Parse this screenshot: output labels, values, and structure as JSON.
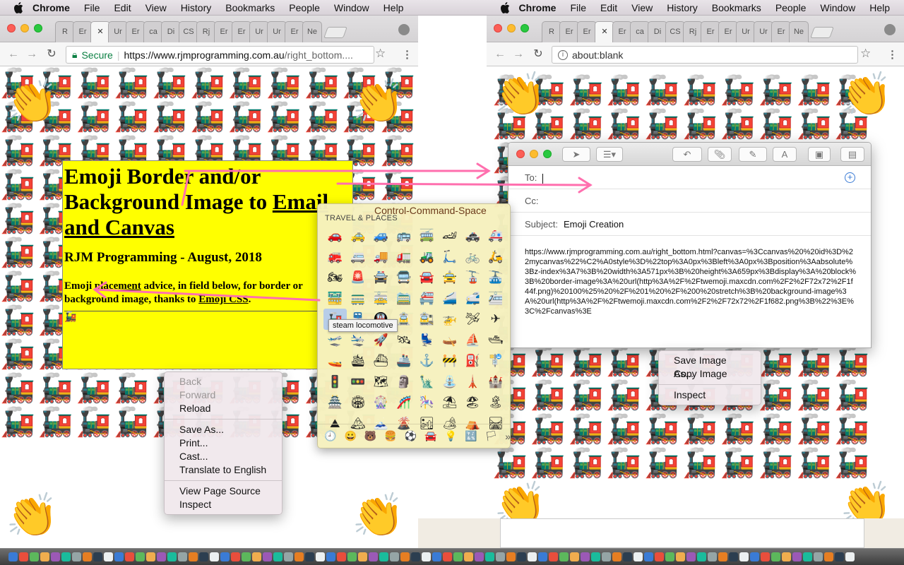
{
  "menubar": {
    "app": "Chrome",
    "items": [
      "File",
      "Edit",
      "View",
      "History",
      "Bookmarks",
      "People",
      "Window",
      "Help"
    ]
  },
  "left_browser": {
    "tabs": [
      "R",
      "Er",
      "",
      "Ur",
      "Er",
      "ca",
      "Di",
      "CS",
      "Rj",
      "Er",
      "Er",
      "Ur",
      "Ur",
      "Er",
      "Ne"
    ],
    "active_tab": 2,
    "secure_label": "Secure",
    "url_host": "https://www.rjmprogramming.com.au",
    "url_rest": "/right_bottom....",
    "page": {
      "title_line1": "Emoji Border and/or",
      "title_line2a": "Background Image to ",
      "title_link": "Email",
      "title_line3": "and Canvas",
      "subtitle": "RJM Programming - August, 2018",
      "para_start": "Emoji ",
      "para_link1": "placement",
      "para_mid": " advice, in field below, for border or background image, thanks to ",
      "para_link2": "Emoji CSS",
      "para_end": ".",
      "field_value": "🚂"
    }
  },
  "right_browser": {
    "tabs": [
      "R",
      "Er",
      "Er",
      "",
      "Er",
      "ca",
      "Di",
      "CS",
      "Rj",
      "Er",
      "Er",
      "Ur",
      "Ur",
      "Er",
      "Ne"
    ],
    "active_tab": 3,
    "url": "about:blank"
  },
  "page_context_menu": {
    "back": "Back",
    "forward": "Forward",
    "reload": "Reload",
    "save_as": "Save As...",
    "print": "Print...",
    "cast": "Cast...",
    "translate": "Translate to English",
    "view_source": "View Page Source",
    "inspect": "Inspect"
  },
  "image_context_menu": {
    "save_image": "Save Image As...",
    "copy_image": "Copy Image",
    "inspect": "Inspect"
  },
  "emoji_picker": {
    "hint": "Control-Command-Space",
    "category": "TRAVEL & PLACES",
    "tooltip": "steam locomotive",
    "selected_index": 32,
    "emojis": [
      "🚗",
      "🚕",
      "🚙",
      "🚌",
      "🚎",
      "🏎",
      "🚓",
      "🚑",
      "🚒",
      "🚐",
      "🚚",
      "🚛",
      "🚜",
      "🛴",
      "🚲",
      "🛵",
      "🏍",
      "🚨",
      "🚔",
      "🚍",
      "🚘",
      "🚖",
      "🚡",
      "🚠",
      "🚟",
      "🚃",
      "🚋",
      "🚞",
      "🚝",
      "🚄",
      "🚅",
      "🚈",
      "🚂",
      "🚆",
      "🚇",
      "🚊",
      "🚉",
      "🚁",
      "🛩",
      "✈",
      "🛫",
      "🛬",
      "🚀",
      "🛰",
      "💺",
      "🛶",
      "⛵",
      "🛥",
      "🚤",
      "🛳",
      "⛴",
      "🚢",
      "⚓",
      "🚧",
      "⛽",
      "🚏",
      "🚦",
      "🚥",
      "🗺",
      "🗿",
      "🗽",
      "⛲",
      "🗼",
      "🏰",
      "🏯",
      "🏟",
      "🎡",
      "🎢",
      "🎠",
      "⛱",
      "🏖",
      "🏝",
      "⛰",
      "🏔",
      "🗻",
      "🌋",
      "🏜",
      "🏕",
      "⛺",
      "🛤"
    ],
    "category_icons": [
      "🕘",
      "😀",
      "🐻",
      "🍔",
      "⚽",
      "🚘",
      "💡",
      "🔣",
      "🏳",
      "»"
    ]
  },
  "mail": {
    "to_label": "To:",
    "cc_label": "Cc:",
    "subject_label": "Subject:",
    "subject_value": "Emoji Creation",
    "body": "https://www.rjmprogramming.com.au/right_bottom.html?canvas=%3Ccanvas%20%20id%3D%22mycanvas%22%C2%A0style%3D%22top%3A0px%3Bleft%3A0px%3Bposition%3Aabsolute%3Bz-index%3A7%3B%20width%3A571px%3B%20height%3A659px%3Bdisplay%3A%20block%3B%20border-image%3A%20url(http%3A%2F%2Ftwemoji.maxcdn.com%2F2%2F72x72%2F1f44f.png)%20100%25%20%2F%201%20%2F%200%20stretch%3B%20background-image%3A%20url(http%3A%2F%2Ftwemoji.maxcdn.com%2F2%2F72x72%2F1f682.png%3B%22%3E%3C%2Fcanvas%3E"
  },
  "background_emoji": "🚂",
  "corner_emoji": "👏",
  "colors": {
    "accent_yellow": "#ffff00",
    "arrow_pink": "#ff6fae",
    "secure_green": "#0b8043"
  }
}
